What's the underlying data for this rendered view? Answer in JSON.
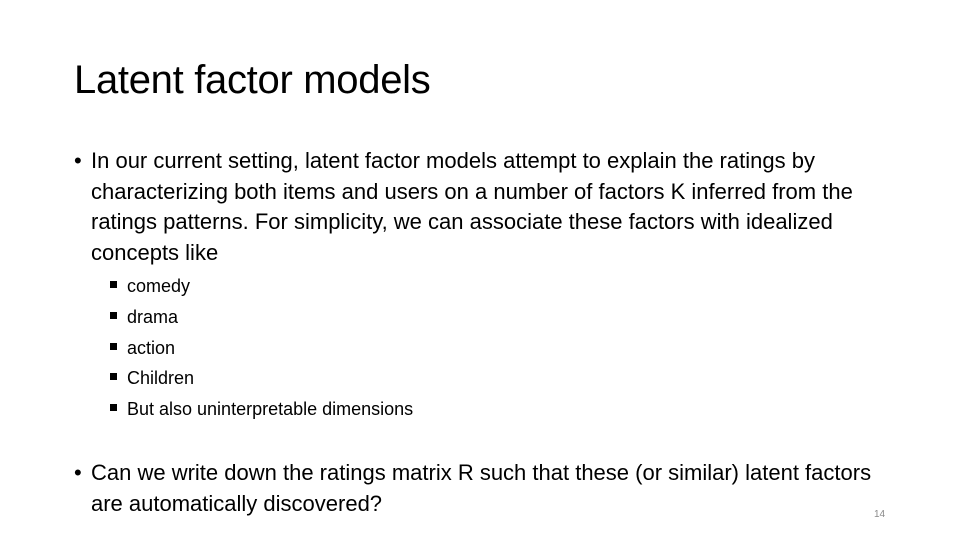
{
  "slide": {
    "title": "Latent factor models",
    "bullets": [
      {
        "marker": "•",
        "text": "In our current setting, latent factor models attempt to explain the ratings by characterizing both items and users on a number of factors K inferred from the ratings patterns. For simplicity, we can associate these factors with idealized concepts like"
      },
      {
        "marker": "•",
        "text": "Can we write down the ratings matrix R such that these (or similar) latent factors are automatically discovered?"
      }
    ],
    "subitems": [
      {
        "label": "comedy"
      },
      {
        "label": "drama"
      },
      {
        "label": "action"
      },
      {
        "label": "Children"
      },
      {
        "label": "But also uninterpretable dimensions"
      }
    ],
    "page_number": "14"
  },
  "colors": {
    "text": "#000000",
    "background": "#ffffff",
    "page_number": "#8a8a8a"
  }
}
